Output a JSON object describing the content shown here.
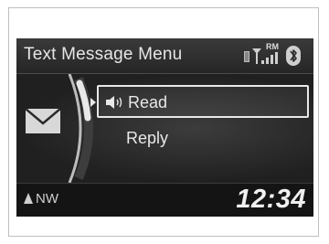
{
  "header": {
    "title": "Text Message Menu"
  },
  "status": {
    "phone_icon": "phone-battery-icon",
    "signal_icon": "signal-strength-icon",
    "roaming_label": "RM",
    "bluetooth_icon": "bluetooth-icon"
  },
  "menu": {
    "icon": "envelope-icon",
    "items": [
      {
        "label": "Read",
        "selected": true,
        "icon": "speaker-icon"
      },
      {
        "label": "Reply",
        "selected": false
      }
    ]
  },
  "footer": {
    "compass_heading": "NW",
    "clock": "12:34"
  },
  "colors": {
    "screen_bg": "#1a1a1a",
    "text": "#e8e8e8",
    "highlight_border": "#e8e8e8"
  }
}
